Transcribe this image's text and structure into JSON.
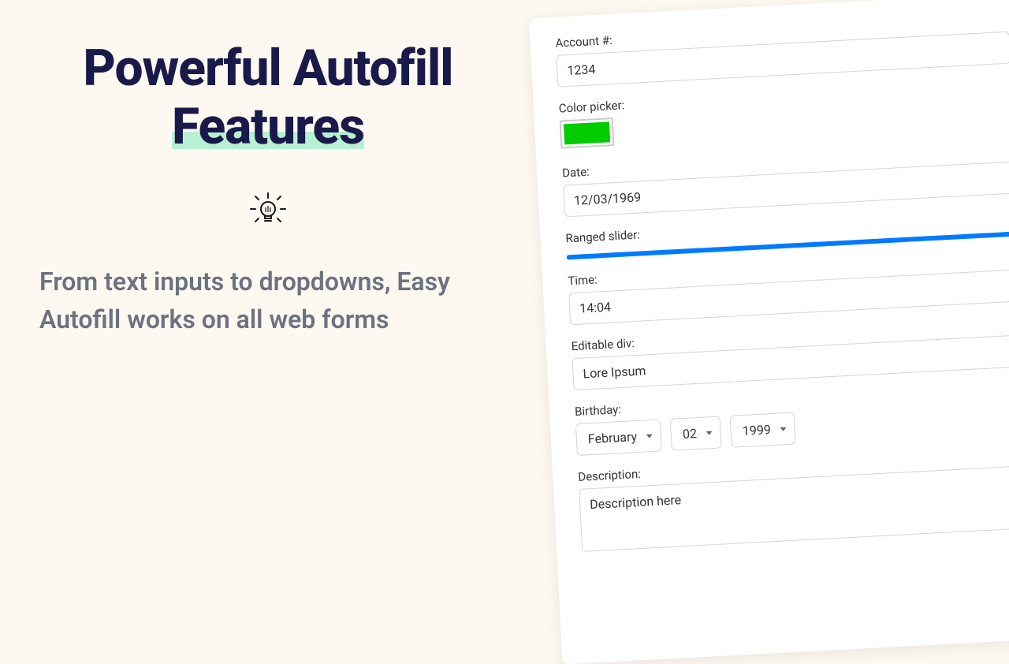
{
  "hero": {
    "title_line1": "Powerful Autofill",
    "title_line2": "Features",
    "subtitle": "From text inputs to dropdowns, Easy Autofill works on all web forms"
  },
  "form": {
    "account": {
      "label": "Account #:",
      "value": "1234"
    },
    "color_picker": {
      "label": "Color picker:",
      "value": "#00cc00"
    },
    "date": {
      "label": "Date:",
      "value": "12/03/1969"
    },
    "ranged_slider": {
      "label": "Ranged slider:"
    },
    "time": {
      "label": "Time:",
      "value": "14:04"
    },
    "editable_div": {
      "label": "Editable div:",
      "value": "Lore Ipsum"
    },
    "birthday": {
      "label": "Birthday:",
      "month": "February",
      "day": "02",
      "year": "1999"
    },
    "description": {
      "label": "Description:",
      "value": "Description here"
    }
  }
}
